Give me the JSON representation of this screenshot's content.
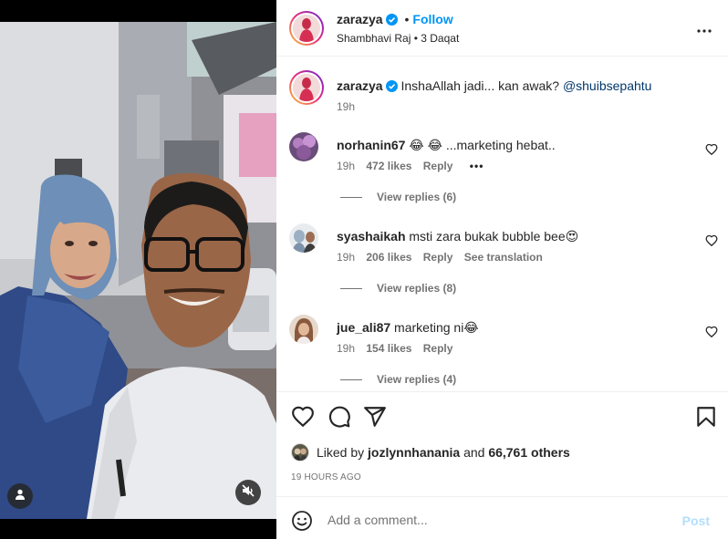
{
  "post": {
    "author": "zarazya",
    "follow_label": "Follow",
    "separator": "•",
    "location": "Shambhavi Raj • 3 Daqat",
    "more_icon": "more-horizontal-icon"
  },
  "caption": {
    "username": "zarazya",
    "text": "InshaAllah jadi... kan awak?",
    "mention": "@shuibsepahtu",
    "time": "19h"
  },
  "comments": [
    {
      "username": "norhanin67",
      "text": "😂 😂 ...marketing hebat..",
      "time": "19h",
      "likes": "472 likes",
      "reply": "Reply",
      "extra": "",
      "more": "•••",
      "view_replies": "View replies (6)"
    },
    {
      "username": "syashaikah",
      "text": "msti zara bukak bubble bee😍",
      "time": "19h",
      "likes": "206 likes",
      "reply": "Reply",
      "extra": "See translation",
      "more": "",
      "view_replies": "View replies (8)"
    },
    {
      "username": "jue_ali87",
      "text": "marketing ni😂",
      "time": "19h",
      "likes": "154 likes",
      "reply": "Reply",
      "extra": "",
      "more": "",
      "view_replies": "View replies (4)"
    }
  ],
  "actions": {
    "icons": [
      "heart-icon",
      "comment-icon",
      "share-icon",
      "bookmark-icon"
    ],
    "liked_prefix": "Liked by",
    "liked_user": "jozlynnhanania",
    "liked_and": "and",
    "liked_others": "66,761 others",
    "post_time": "19 HOURS AGO"
  },
  "comment_box": {
    "placeholder": "Add a comment...",
    "post_label": "Post"
  },
  "colors": {
    "follow_blue": "#0095f6",
    "mention_blue": "#00376b",
    "verified_blue": "#0095f6",
    "post_disabled": "#b2dffc"
  }
}
